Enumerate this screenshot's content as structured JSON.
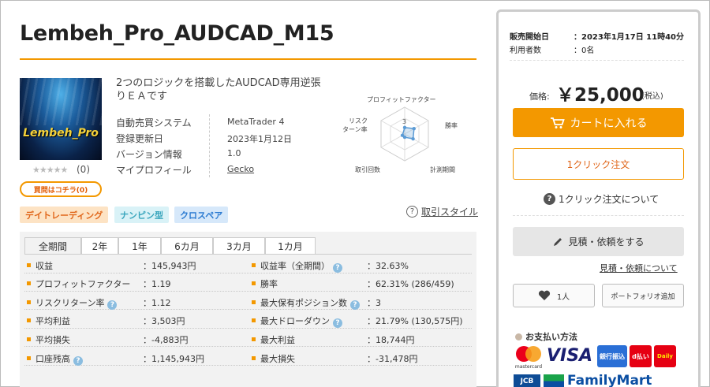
{
  "product": {
    "title": "Lembeh_Pro_AUDCAD_M15",
    "thumbnail_text": "Lembeh_Pro",
    "stars": "★★★★★",
    "review_count": "(0)",
    "buy_badge": "買問はコチラ(0)",
    "description": "2つのロジックを搭載したAUDCAD専用逆張りＥＡです"
  },
  "info": [
    {
      "label": "自動売買システム",
      "value": "MetaTrader 4"
    },
    {
      "label": "登録更新日",
      "value": "2023年1月12日"
    },
    {
      "label": "バージョン情報",
      "value": "1.0"
    },
    {
      "label": "マイプロフィール",
      "value": "Gecko"
    }
  ],
  "radar": {
    "labels": [
      "プロフィットファクター",
      "勝率",
      "計測期間",
      "取引回数",
      "リスク",
      "ターン率"
    ],
    "scale_label": "3",
    "values": [
      1.2,
      2.0,
      1.8,
      0.6,
      0.5
    ],
    "max": 5
  },
  "tags": [
    "デイトレーディング",
    "ナンピン型",
    "クロスペア"
  ],
  "trade_style_link": "取引スタイル",
  "tabs": [
    "全期間",
    "2年",
    "1年",
    "6カ月",
    "3カ月",
    "1カ月"
  ],
  "stats_left": [
    {
      "label": "収益",
      "value": "：145,943円",
      "help": false
    },
    {
      "label": "プロフィットファクター",
      "value": "：1.19",
      "help": false
    },
    {
      "label": "リスクリターン率",
      "value": "：1.12",
      "help": true
    },
    {
      "label": "平均利益",
      "value": "：3,503円",
      "help": false
    },
    {
      "label": "平均損失",
      "value": "：-4,883円",
      "help": false
    },
    {
      "label": "口座残高",
      "value": "：1,145,943円",
      "help": true
    }
  ],
  "stats_right": [
    {
      "label": "収益率（全期間）",
      "value": "：32.63%",
      "help": true
    },
    {
      "label": "勝率",
      "value": "：62.31% (286/459)",
      "help": false
    },
    {
      "label": "最大保有ポジション数",
      "value": "：3",
      "help": true
    },
    {
      "label": "最大ドローダウン",
      "value": "：21.79% (130,575円)",
      "help": true
    },
    {
      "label": "最大利益",
      "value": "：18,744円",
      "help": false
    },
    {
      "label": "最大損失",
      "value": "：-31,478円",
      "help": false
    }
  ],
  "panel": {
    "sale_start_label": "販売開始日",
    "sale_start_value": "：2023年1月17日 11時40分",
    "users_label": "利用者数",
    "users_value": "：0名",
    "price_label": "価格:",
    "price": "￥25,000",
    "tax": "(税込)",
    "cart_button": "カートに入れる",
    "oneclick_button": "1クリック注文",
    "oneclick_about": "1クリック注文について",
    "quote_button": "見積・依頼をする",
    "quote_link": "見積・依頼について",
    "like_count": "1人",
    "portfolio_button": "ポートフォリオ追加",
    "payment_title": "お支払い方法",
    "payment_logos": [
      "mastercard",
      "VISA",
      "銀行振込",
      "d払い",
      "Daily",
      "JCB",
      "FamilyMart"
    ]
  },
  "colors": {
    "accent": "#f39800",
    "help": "#8bbde0",
    "radar": "#5b9bd5"
  }
}
